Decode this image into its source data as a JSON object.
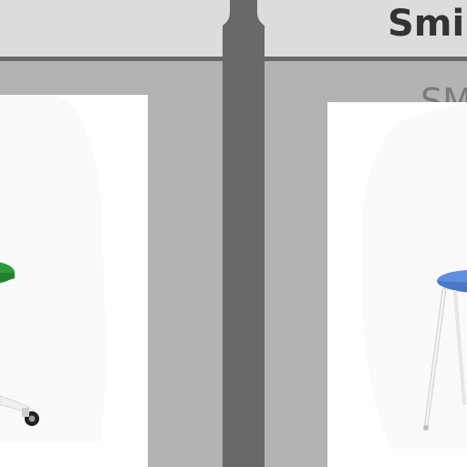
{
  "header": {
    "product_title": "Smi",
    "product_subtitle": "SM"
  },
  "products": [
    {
      "name": "green-stool",
      "accent": "#2f9a3a"
    },
    {
      "name": "blue-stool",
      "accent": "#5f8fe0"
    }
  ]
}
